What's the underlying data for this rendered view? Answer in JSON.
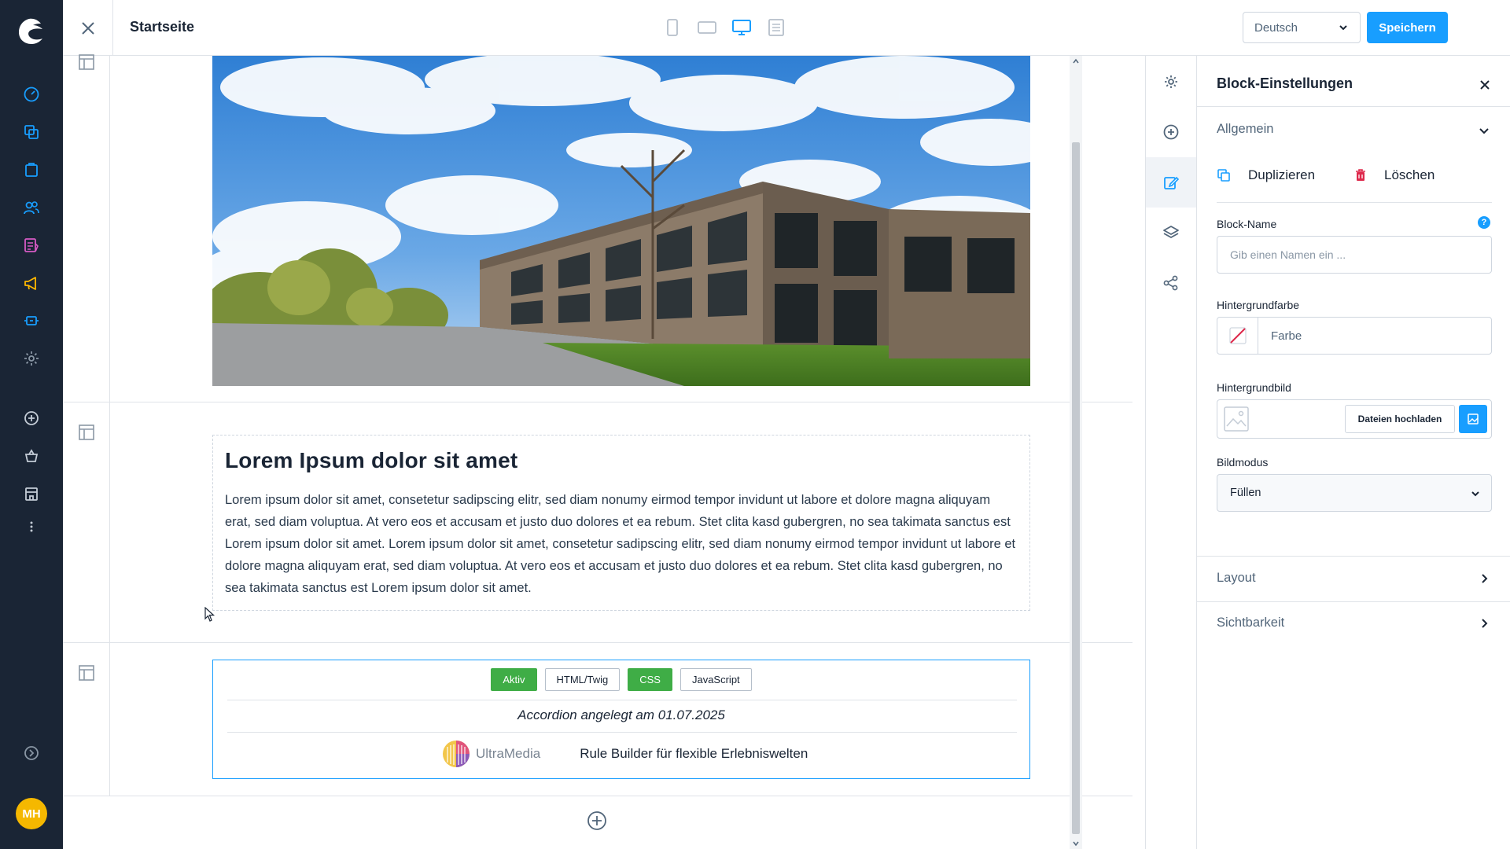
{
  "header": {
    "page_title": "Startseite",
    "language": "Deutsch",
    "save_label": "Speichern"
  },
  "content": {
    "heading": "Lorem Ipsum dolor sit amet",
    "paragraph": "Lorem ipsum dolor sit amet, consetetur sadipscing elitr, sed diam nonumy eirmod tempor invidunt ut labore et dolore magna aliquyam erat, sed diam voluptua. At vero eos et accusam et justo duo dolores et ea rebum. Stet clita kasd gubergren, no sea takimata sanctus est Lorem ipsum dolor sit amet. Lorem ipsum dolor sit amet, consetetur sadipscing elitr, sed diam nonumy eirmod tempor invidunt ut labore et dolore magna aliquyam erat, sed diam voluptua. At vero eos et accusam et justo duo dolores et ea rebum. Stet clita kasd gubergren, no sea takimata sanctus est Lorem ipsum dolor sit amet.",
    "tabs": [
      "Aktiv",
      "HTML/Twig",
      "CSS",
      "JavaScript"
    ],
    "accordion_text": "Accordion angelegt am 01.07.2025",
    "brand_logo": "UltraMedia",
    "rule_builder_text": "Rule Builder für flexible Erlebniswelten"
  },
  "sidebar": {
    "title": "Block-Einstellungen",
    "section_general": "Allgemein",
    "duplicate_label": "Duplizieren",
    "delete_label": "Löschen",
    "block_name_label": "Block-Name",
    "block_name_placeholder": "Gib einen Namen ein ...",
    "help_glyph": "?",
    "bg_color_label": "Hintergrundfarbe",
    "bg_color_value": "Farbe",
    "bg_image_label": "Hintergrundbild",
    "upload_label": "Dateien hochladen",
    "image_mode_label": "Bildmodus",
    "image_mode_value": "Füllen",
    "section_layout": "Layout",
    "section_visibility": "Sichtbarkeit"
  },
  "user": {
    "initials": "MH"
  },
  "colors": {
    "nav_bg": "#1a2535",
    "accent": "#189eff",
    "tab_active": "#3fad46",
    "avatar": "#f5b800",
    "delete": "#de294c"
  }
}
